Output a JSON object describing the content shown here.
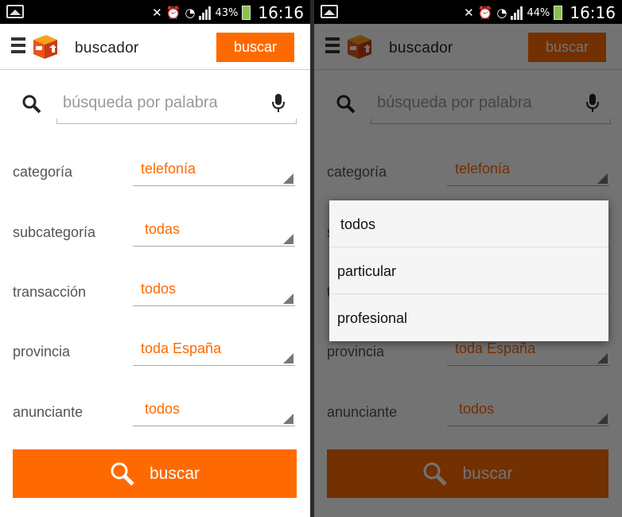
{
  "status_left": {
    "battery": "43%",
    "time": "16:16"
  },
  "status_right": {
    "battery": "44%",
    "time": "16:16"
  },
  "app": {
    "title": "buscador",
    "top_button": "buscar"
  },
  "search": {
    "placeholder": "búsqueda por palabra"
  },
  "filters": [
    {
      "label": "categoría",
      "value": "telefonía"
    },
    {
      "label": "subcategoría",
      "value": "todas"
    },
    {
      "label": "transacción",
      "value": "todos"
    },
    {
      "label": "provincia",
      "value": "toda España"
    },
    {
      "label": "anunciante",
      "value": "todos"
    }
  ],
  "main_button": "buscar",
  "dropdown": {
    "options": [
      "todos",
      "particular",
      "profesional"
    ]
  },
  "colors": {
    "accent": "#ff6a00",
    "dim": "rgba(0,0,0,0.55)"
  }
}
